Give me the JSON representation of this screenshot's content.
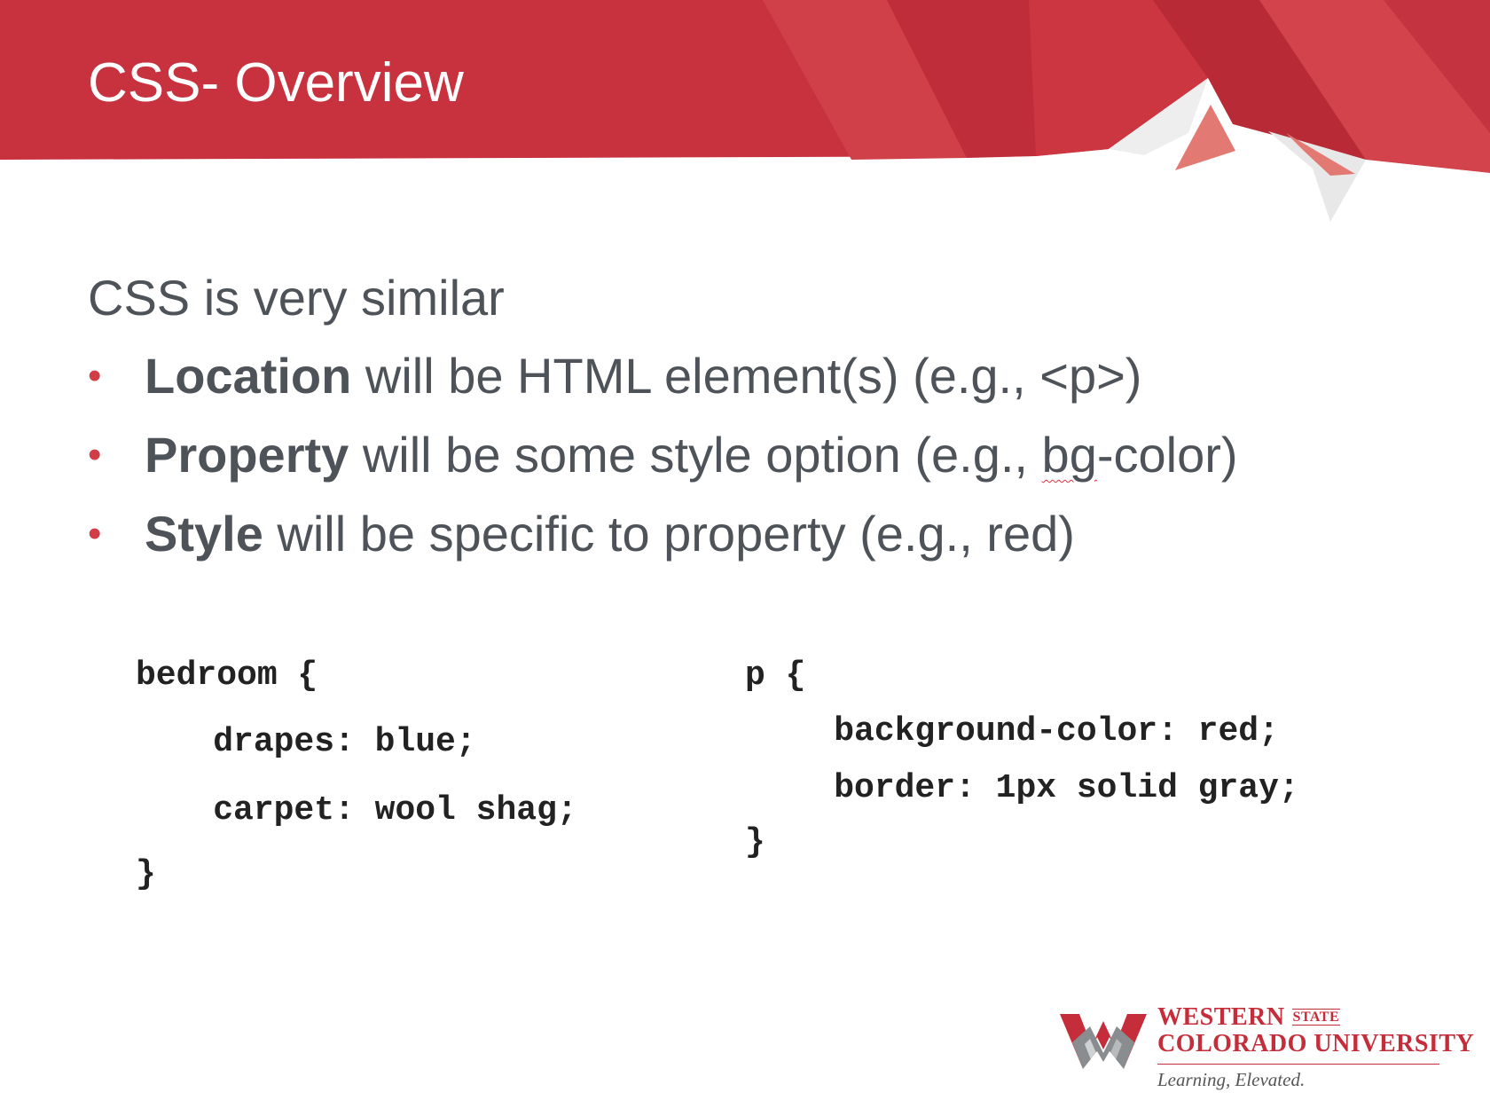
{
  "slide": {
    "title": "CSS- Overview",
    "intro": "CSS is very similar",
    "bullets": [
      {
        "term": "Location",
        "rest": " will be HTML element(s) (e.g., <p>)"
      },
      {
        "term": "Property",
        "rest_before": " will be some style option (e.g., ",
        "misspelled": "bg",
        "rest_after": "-color)"
      },
      {
        "term": "Style",
        "rest": " will be specific to property (e.g., red)"
      }
    ],
    "code_left": [
      "bedroom {",
      "    drapes: blue;",
      "    carpet: wool shag;",
      "}"
    ],
    "code_right": [
      "p {",
      "    background-color: red;",
      "    border: 1px solid gray;",
      "}"
    ]
  },
  "logo": {
    "line1": "WESTERN",
    "state": "STATE",
    "line2": "COLORADO UNIVERSITY",
    "tagline": "Learning, Elevated."
  },
  "colors": {
    "header_red": "#c8323f",
    "accent_red": "#d13c46",
    "body_text": "#4d5358"
  },
  "icons": [
    "bullet-dot",
    "mountain-graphic",
    "university-logo-mark"
  ]
}
